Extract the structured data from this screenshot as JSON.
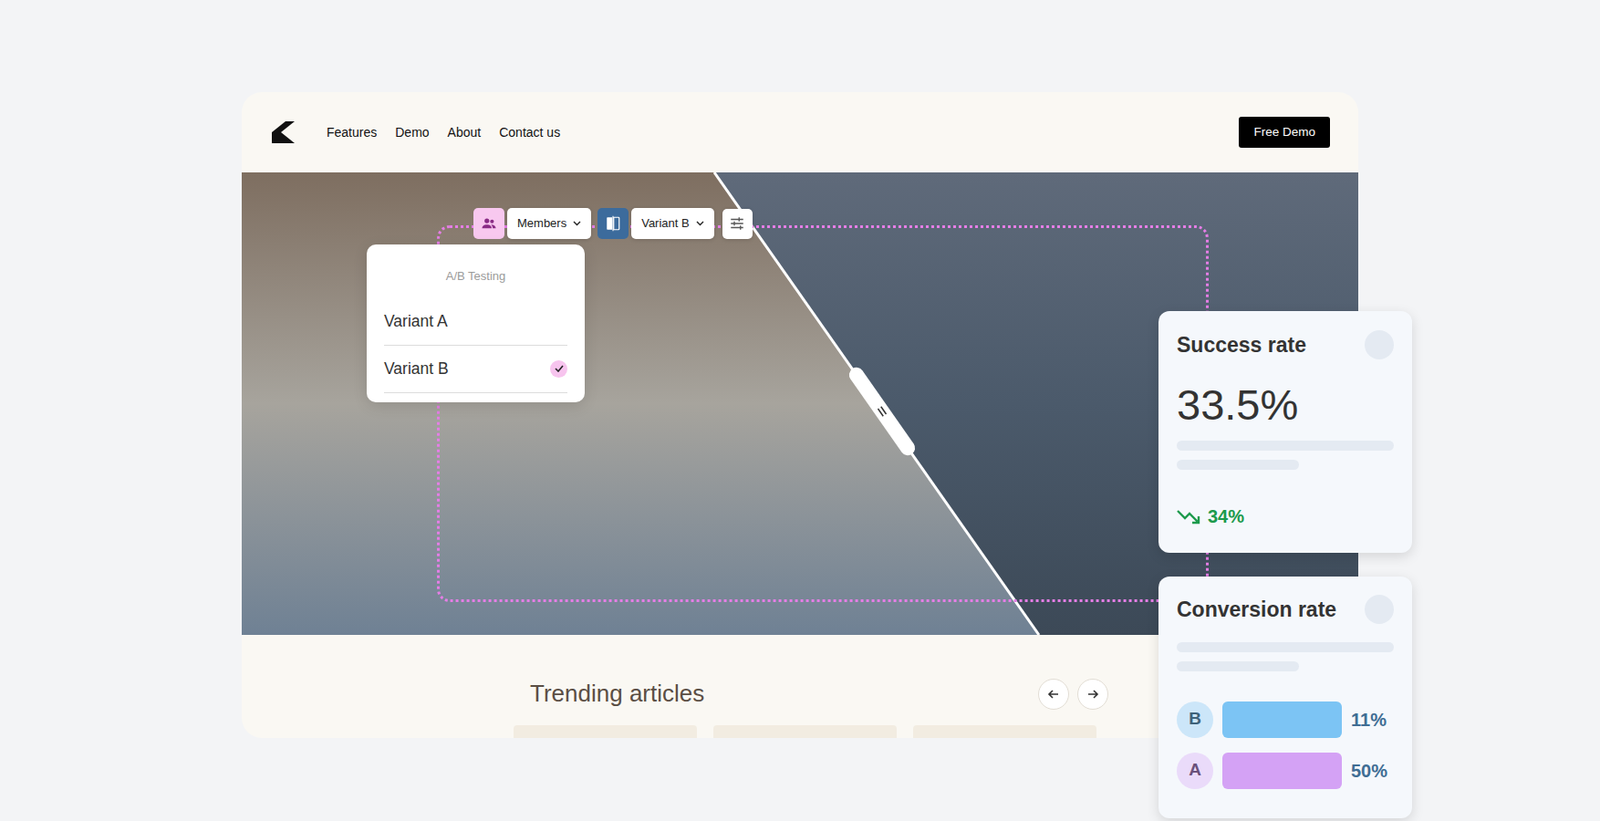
{
  "nav": {
    "links": [
      {
        "label": "Features"
      },
      {
        "label": "Demo"
      },
      {
        "label": "About"
      },
      {
        "label": "Contact us"
      }
    ],
    "cta": "Free Demo"
  },
  "toolbar": {
    "audience": "Members",
    "variant": "Variant B"
  },
  "menu": {
    "title": "A/B Testing",
    "items": [
      {
        "label": "Variant A",
        "selected": false
      },
      {
        "label": "Variant B",
        "selected": true
      }
    ]
  },
  "success_card": {
    "title": "Success rate",
    "value": "33.5%",
    "change": "34%"
  },
  "conversion_card": {
    "title": "Conversion rate",
    "bars": [
      {
        "label": "B",
        "value": "11%",
        "color": "#7cc4f4"
      },
      {
        "label": "A",
        "value": "50%",
        "color": "#d4a2f5"
      }
    ]
  },
  "articles": {
    "title": "Trending articles"
  }
}
